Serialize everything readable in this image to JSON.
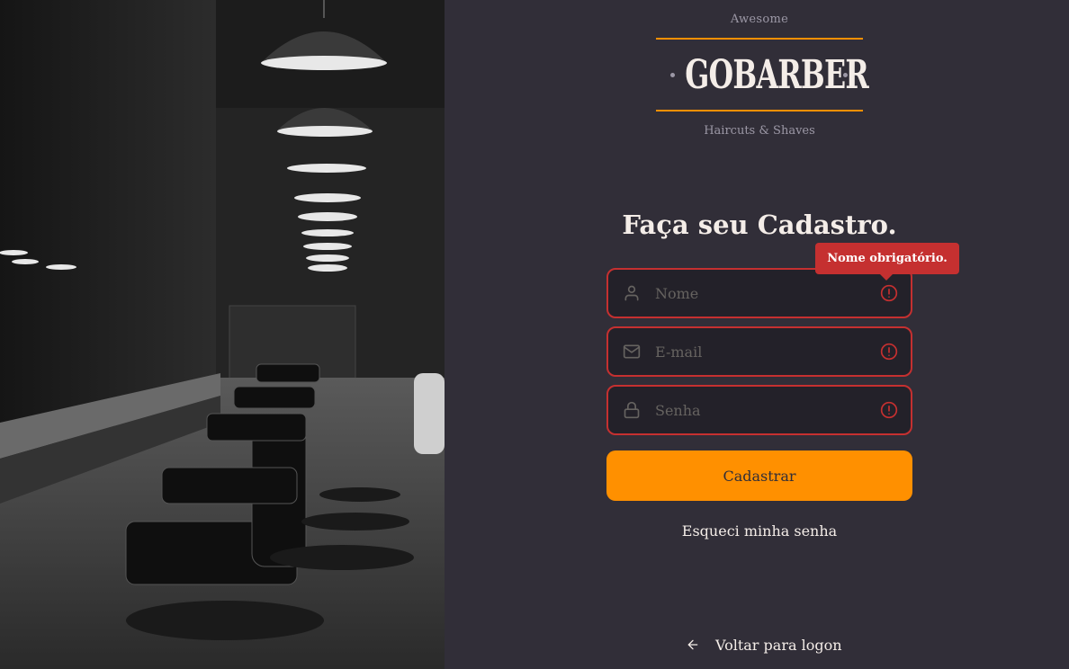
{
  "logo": {
    "top_text": "Awesome",
    "main_text": "GOBARBER",
    "bottom_text": "Haircuts & Shaves"
  },
  "form": {
    "title": "Faça seu Cadastro.",
    "fields": [
      {
        "placeholder": "Nome",
        "icon": "user-icon",
        "value": ""
      },
      {
        "placeholder": "E-mail",
        "icon": "mail-icon",
        "value": ""
      },
      {
        "placeholder": "Senha",
        "icon": "lock-icon",
        "value": ""
      }
    ],
    "error_tooltip": "Nome obrigatório.",
    "submit_label": "Cadastrar",
    "forgot_label": "Esqueci minha senha"
  },
  "back_link": {
    "label": "Voltar para logon",
    "icon": "arrow-left-icon"
  },
  "colors": {
    "background": "#312e38",
    "input_bg": "#232129",
    "accent": "#ff9000",
    "error": "#c53030",
    "text": "#f4ede8",
    "muted": "#666360"
  }
}
